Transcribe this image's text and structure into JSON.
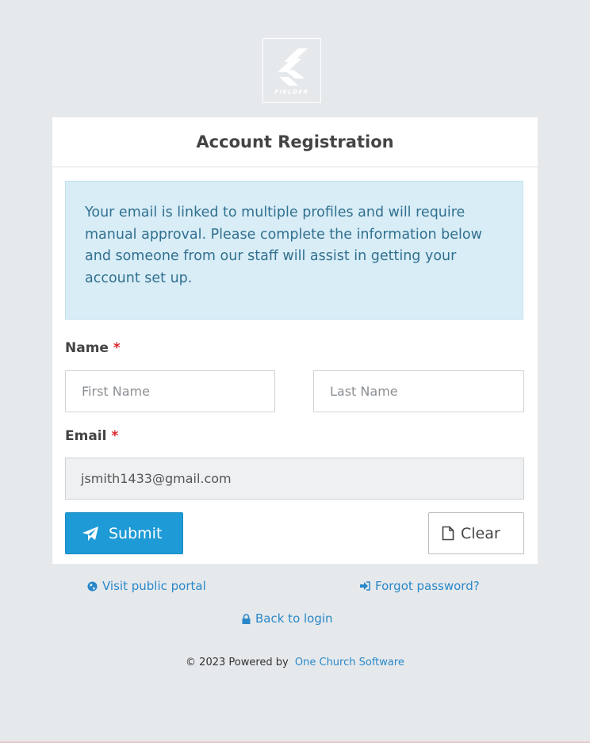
{
  "logo": {
    "text": "FIELDER"
  },
  "card": {
    "title": "Account Registration",
    "alert": "Your email is linked to multiple profiles and will require manual approval. Please complete the information below and someone from our staff will assist in getting your account set up."
  },
  "form": {
    "name_label": "Name",
    "email_label": "Email",
    "required_mark": "*",
    "first_name_placeholder": "First Name",
    "last_name_placeholder": "Last Name",
    "email_value": "jsmith1433@gmail.com",
    "submit_label": "Submit",
    "clear_label": "Clear"
  },
  "links": {
    "public_portal": "Visit public portal",
    "forgot_password": "Forgot password?",
    "back_to_login": "Back to login"
  },
  "footer": {
    "text": "© 2023 Powered by",
    "brand": "One Church Software"
  },
  "colors": {
    "background": "#e6e9ec",
    "accent": "#1e9ad6",
    "alert_bg": "#d9edf7",
    "alert_text": "#31708f",
    "required": "#d9262e",
    "link": "#2a88c8"
  }
}
